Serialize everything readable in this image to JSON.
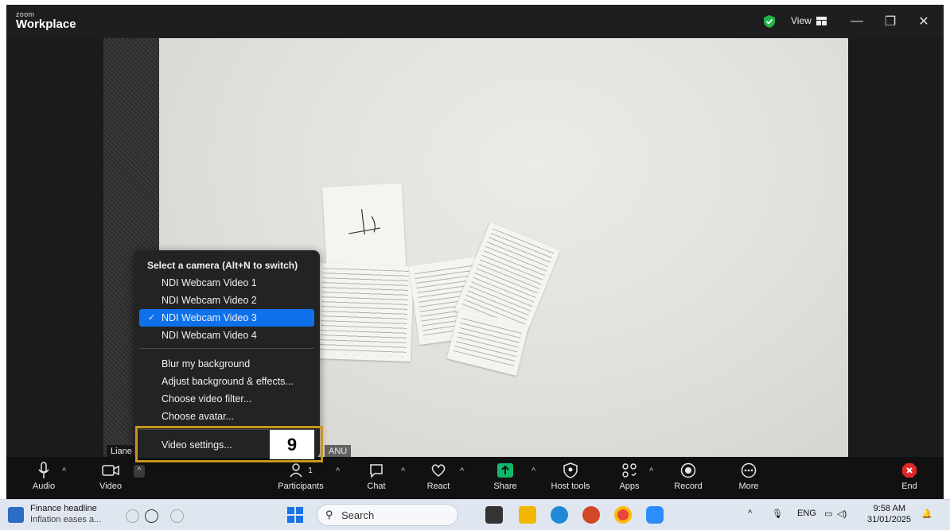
{
  "titlebar": {
    "brand_small": "zoom",
    "brand_big": "Workplace",
    "view_label": "View",
    "minimize_glyph": "—",
    "restore_glyph": "❐",
    "close_glyph": "✕"
  },
  "video": {
    "participant_name": "Liane",
    "second_name_tag": "ANU"
  },
  "camera_menu": {
    "title": "Select a camera (Alt+N to switch)",
    "cameras": [
      {
        "label": "NDI Webcam Video 1",
        "selected": false
      },
      {
        "label": "NDI Webcam Video 2",
        "selected": false
      },
      {
        "label": "NDI Webcam Video 3",
        "selected": true
      },
      {
        "label": "NDI Webcam Video 4",
        "selected": false
      }
    ],
    "options": [
      "Blur my background",
      "Adjust background & effects...",
      "Choose video filter...",
      "Choose avatar..."
    ],
    "settings": "Video settings..."
  },
  "step_badge": "9",
  "toolbar": {
    "audio": "Audio",
    "video": "Video",
    "participants": "Participants",
    "participants_count": "1",
    "chat": "Chat",
    "react": "React",
    "share": "Share",
    "host_tools": "Host tools",
    "apps": "Apps",
    "record": "Record",
    "more": "More",
    "end": "End"
  },
  "taskbar": {
    "news_title": "Finance headline",
    "news_sub": "Inflation eases a...",
    "search_placeholder": "Search",
    "lang": "ENG",
    "time": "9:58 AM",
    "date": "31/01/2025"
  },
  "colors": {
    "accent_blue": "#0e71eb",
    "highlight_gold": "#c8961e",
    "share_green": "#12b76a",
    "end_red": "#e02828"
  }
}
